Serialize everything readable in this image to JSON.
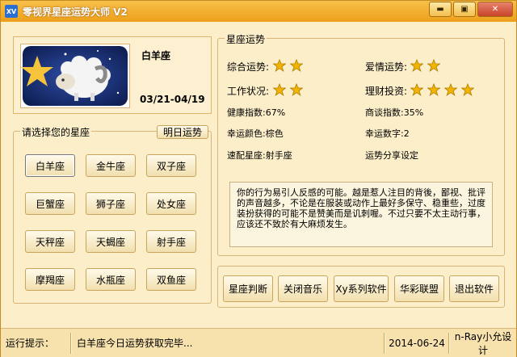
{
  "window": {
    "title": "零视界星座运势大师 V2",
    "icon_text": "XV"
  },
  "titlebar_buttons": {
    "minimize": "▬",
    "maximize": "▣",
    "close": "✕"
  },
  "sign_info": {
    "name": "白羊座",
    "dates": "03/21-04/19"
  },
  "select_group": {
    "label": "请选择您的星座",
    "tomorrow_button": "明日运势",
    "signs": [
      "白羊座",
      "金牛座",
      "双子座",
      "巨蟹座",
      "狮子座",
      "处女座",
      "天秤座",
      "天蝎座",
      "射手座",
      "摩羯座",
      "水瓶座",
      "双鱼座"
    ],
    "selected": "白羊座"
  },
  "fortune": {
    "label": "星座运势",
    "overall": {
      "label": "综合运势:",
      "stars": 2
    },
    "love": {
      "label": "爱情运势:",
      "stars": 2
    },
    "work": {
      "label": "工作状况:",
      "stars": 2
    },
    "finance": {
      "label": "理财投资:",
      "stars": 4
    },
    "health": "健康指数:67%",
    "negotiation": "商谈指数:35%",
    "lucky_color": "幸运颜色:棕色",
    "lucky_number": "幸运数字:2",
    "match": "速配星座:射手座",
    "share": "运势分享设定",
    "description": "你的行为易引人反感的可能。越是惹人注目的背後，鄙视、批评的声音越多，不论是在服装或动作上最好多保守、稳重些，过度装扮获得的可能不是赞美而是讥刺喔。不过只要不太主动行事，应该还不致於有大麻烦发生。"
  },
  "actions": [
    "星座判断",
    "关闭音乐",
    "Xy系列软件",
    "华彩联盟",
    "退出软件"
  ],
  "status": {
    "label": "运行提示：",
    "message": "白羊座今日运势获取完毕...",
    "date": "2014-06-24",
    "credit": "n-Ray小允设计"
  },
  "colors": {
    "star": "#f2b400",
    "accent": "#eda01a"
  }
}
